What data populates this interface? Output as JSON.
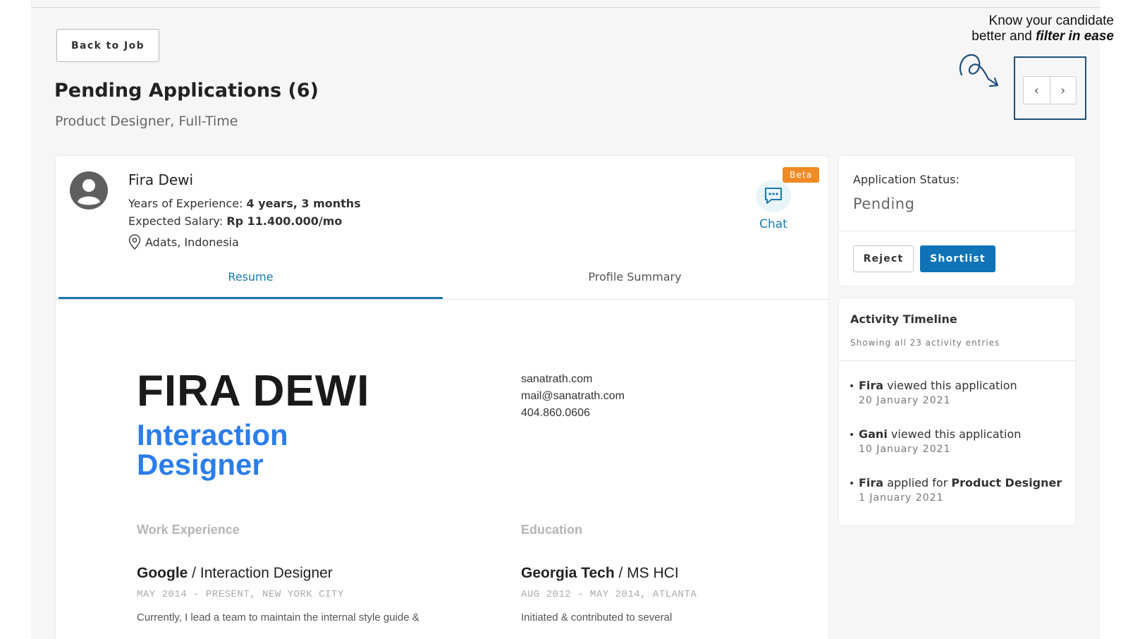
{
  "header": {
    "back_label": "Back to Job",
    "title": "Pending Applications (6)",
    "subtitle": "Product Designer, Full-Time"
  },
  "callout": {
    "line1": "Know your candidate",
    "line2_prefix": "better and ",
    "line2_bold": "filter in ease"
  },
  "pager": {
    "prev_glyph": "‹",
    "next_glyph": "›"
  },
  "candidate": {
    "name": "Fira Dewi",
    "experience_label": "Years of Experience: ",
    "experience_value": "4 years, 3 months",
    "salary_label": "Expected Salary: ",
    "salary_value": "Rp 11.400.000/mo",
    "location": "Adats, Indonesia",
    "chat_label": "Chat",
    "beta_badge": "Beta"
  },
  "tabs": [
    {
      "label": "Resume",
      "active": true
    },
    {
      "label": "Profile Summary",
      "active": false
    }
  ],
  "resume": {
    "name": "FIRA DEWI",
    "role_line1": "Interaction",
    "role_line2": "Designer",
    "contact": [
      "sanatrath.com",
      "mail@sanatrath.com",
      "404.860.0606"
    ],
    "work": {
      "heading": "Work Experience",
      "company": "Google",
      "separator": " / ",
      "position": "Interaction Designer",
      "meta": "MAY 2014 - PRESENT, NEW YORK CITY",
      "desc": "Currently, I lead a team to maintain the internal style guide &"
    },
    "education": {
      "heading": "Education",
      "school": "Georgia Tech",
      "separator": " / ",
      "degree": "MS HCI",
      "meta": "AUG 2012 - MAY 2014, ATLANTA",
      "desc": "Initiated & contributed to several"
    }
  },
  "status": {
    "label": "Application Status:",
    "value": "Pending",
    "reject_label": "Reject",
    "shortlist_label": "Shortlist"
  },
  "timeline": {
    "title": "Activity Timeline",
    "subtitle": "Showing all 23 activity entries",
    "entries": [
      {
        "actor": "Fira",
        "text": " viewed this application",
        "target": "",
        "date": "20 January 2021"
      },
      {
        "actor": "Gani",
        "text": " viewed this application",
        "target": "",
        "date": "10 January 2021"
      },
      {
        "actor": "Fira",
        "text": " applied for ",
        "target": "Product Designer",
        "date": "1 January 2021"
      }
    ]
  },
  "colors": {
    "accent": "#1a78a8",
    "primary_button": "#0f73b6",
    "beta_badge": "#f08a24",
    "resume_role": "#2b7de9",
    "callout_frame": "#1f4f78"
  }
}
